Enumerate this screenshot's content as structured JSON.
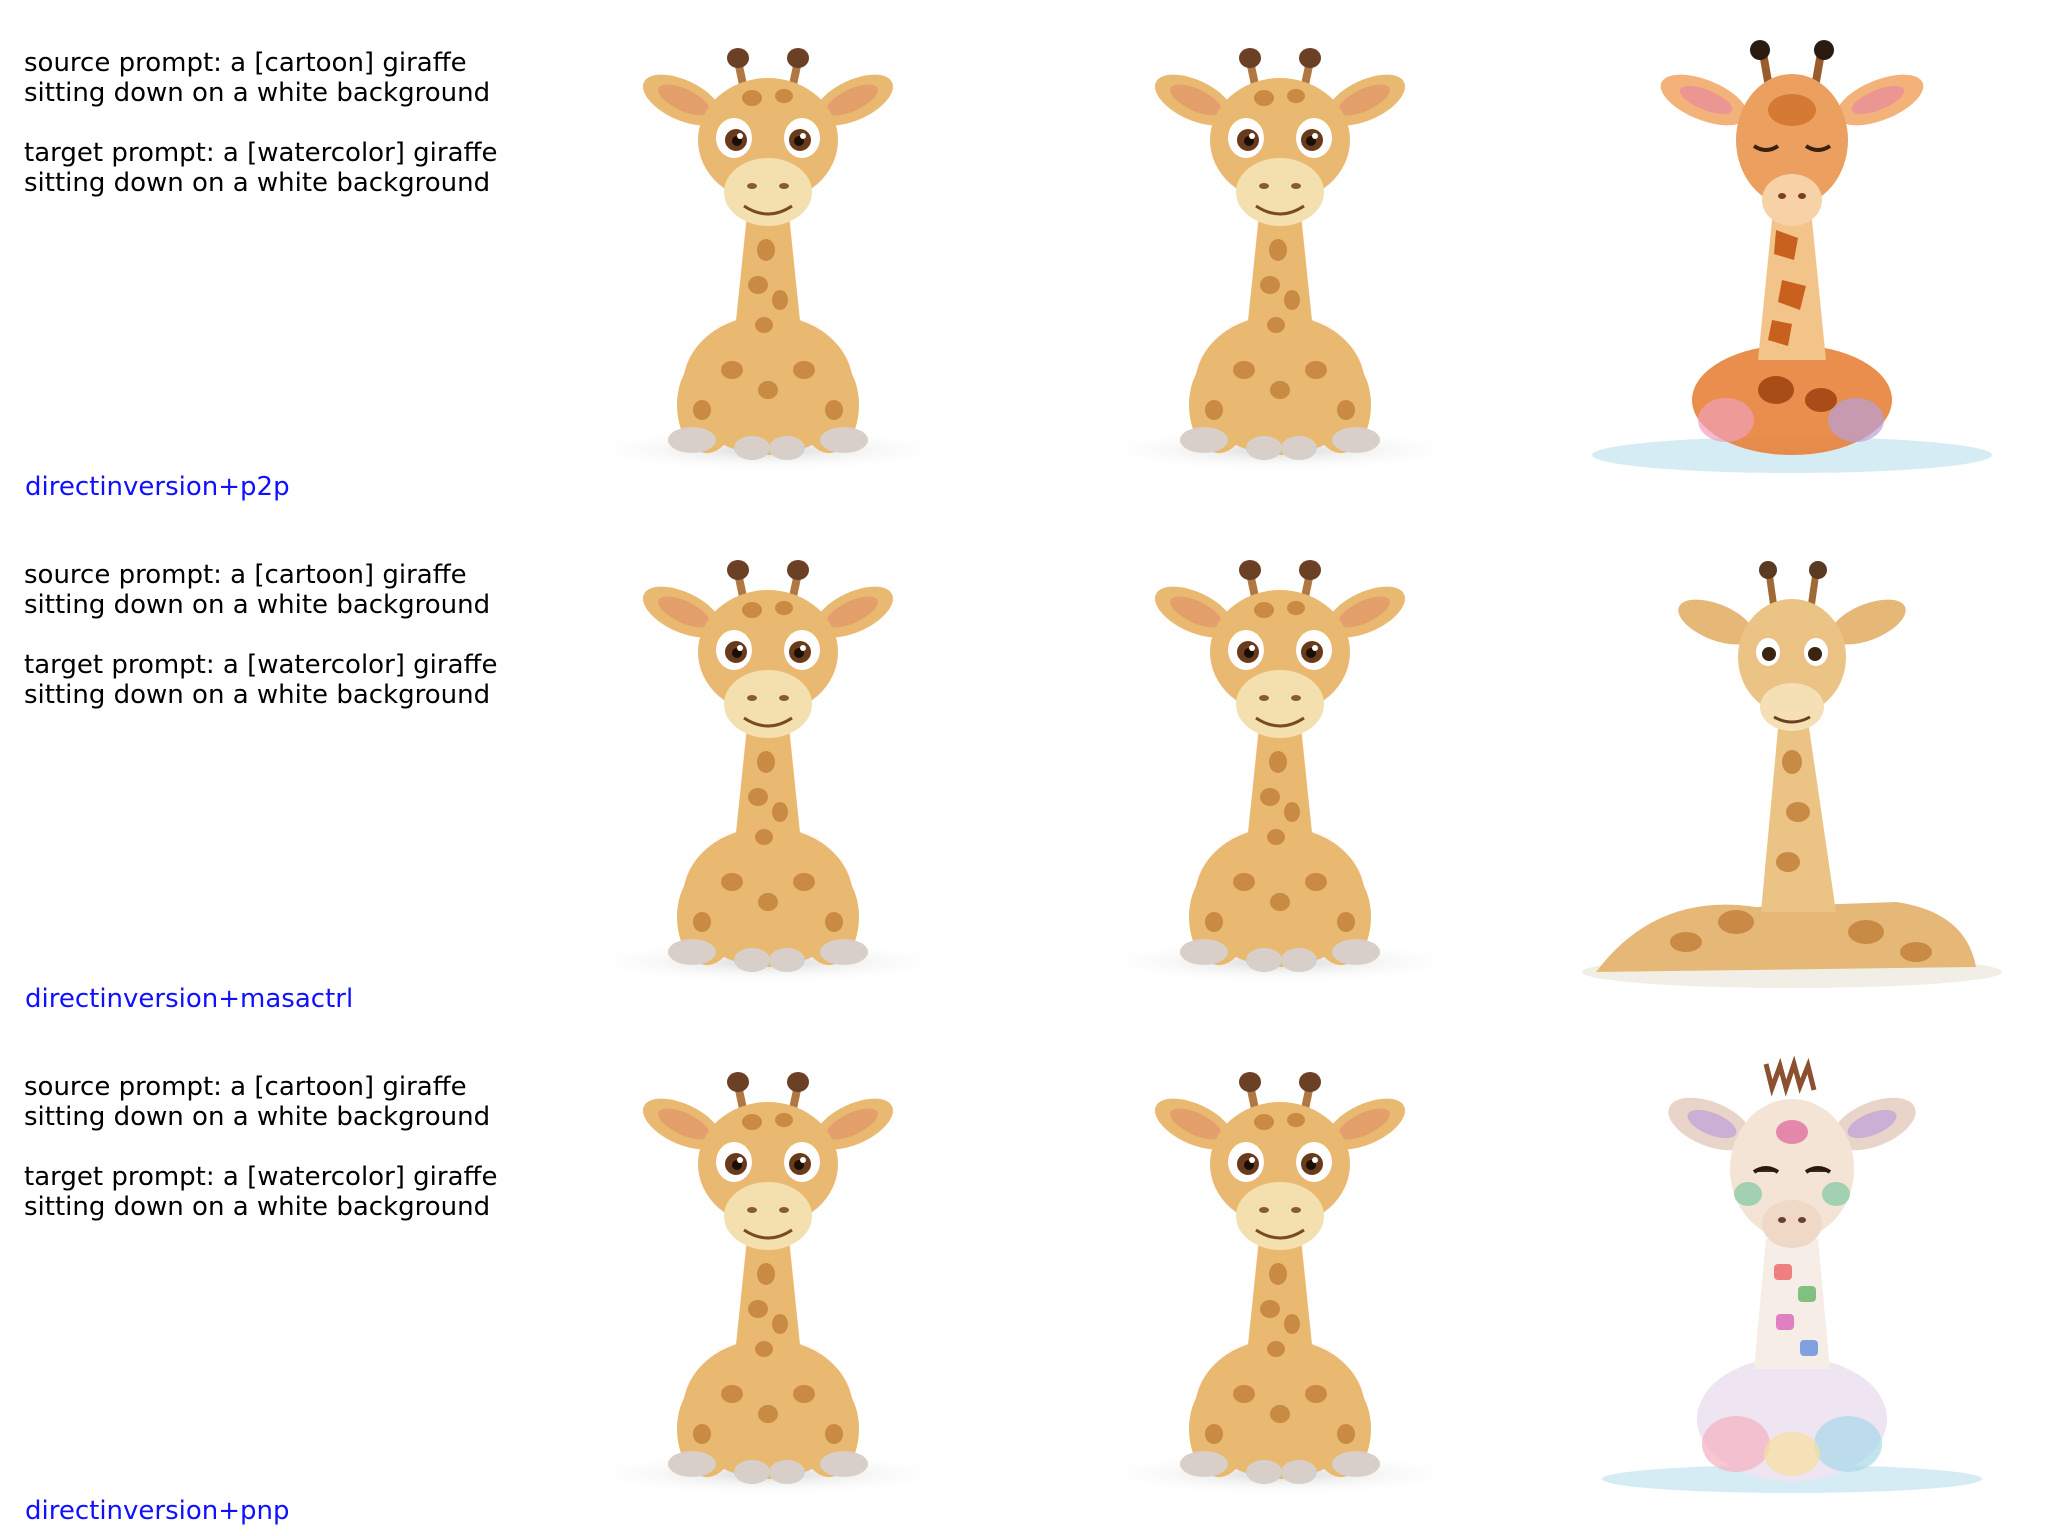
{
  "rows": [
    {
      "source_prompt": "source prompt: a [cartoon] giraffe sitting down on a white background",
      "target_prompt": "target prompt: a [watercolor] giraffe sitting down on a white background",
      "method": "directinversion+p2p",
      "result_style": "watercolor-orange"
    },
    {
      "source_prompt": "source prompt: a [cartoon] giraffe sitting down on a white background",
      "target_prompt": "target prompt: a [watercolor] giraffe sitting down on a white background",
      "method": "directinversion+masactrl",
      "result_style": "watercolor-lying"
    },
    {
      "source_prompt": "source prompt: a [cartoon] giraffe sitting down on a white background",
      "target_prompt": "target prompt: a [watercolor] giraffe sitting down on a white background",
      "method": "directinversion+pnp",
      "result_style": "watercolor-rainbow"
    }
  ],
  "colors": {
    "method_label": "#1010ff",
    "text": "#000000",
    "cartoon_body": "#e9b871",
    "cartoon_spot": "#c98a44",
    "cartoon_muzzle": "#f4dfae"
  }
}
